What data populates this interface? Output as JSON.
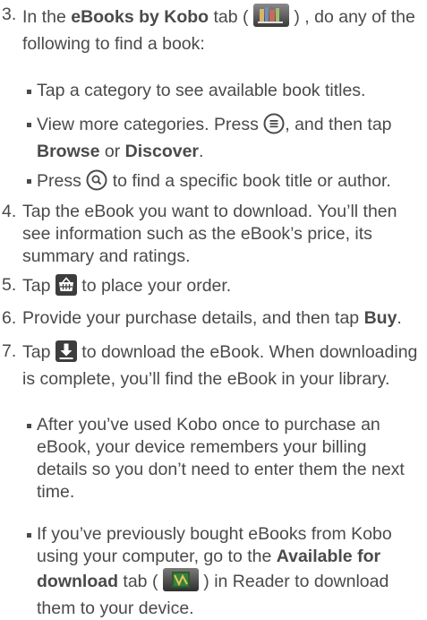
{
  "steps": {
    "s3": {
      "num": "3.",
      "a": "In the",
      "tab": "eBooks by Kobo",
      "b": "tab (",
      "c": ") , do any of the following to find a book:"
    },
    "b1": "Tap a category to see available book titles.",
    "b2": {
      "a": "View more categories. Press",
      "b": ", and then tap",
      "browse": "Browse",
      "or": "or",
      "discover": "Discover",
      "end": "."
    },
    "b3": {
      "a": "Press",
      "b": "to find a specific book title or author."
    },
    "s4": {
      "num": "4.",
      "text": "Tap the eBook you want to download. You’ll then see information such as the eBook’s price, its summary and ratings."
    },
    "s5": {
      "num": "5.",
      "a": "Tap",
      "b": "to place your order."
    },
    "s6": {
      "num": "6.",
      "a": "Provide your purchase details, and then tap",
      "buy": "Buy",
      "end": "."
    },
    "s7": {
      "num": "7.",
      "a": "Tap",
      "b": "to download the eBook. When downloading is complete, you’ll find the eBook in your library."
    },
    "b4": "After you’ve used Kobo once to purchase an eBook, your device remembers your billing details so you don’t need to enter them the next time.",
    "b5": {
      "a": "If you’ve previously bought eBooks from Kobo using your computer, go to the",
      "tab": "Available for download",
      "b": "tab (",
      "c": ") in Reader to download them to your device."
    }
  },
  "icons": {
    "kobo_tab": "kobo-bookshelf-icon",
    "menu": "menu-icon",
    "search": "search-icon",
    "shop": "shopping-basket-icon",
    "download": "download-arrow-icon",
    "available": "available-download-tab-icon"
  }
}
